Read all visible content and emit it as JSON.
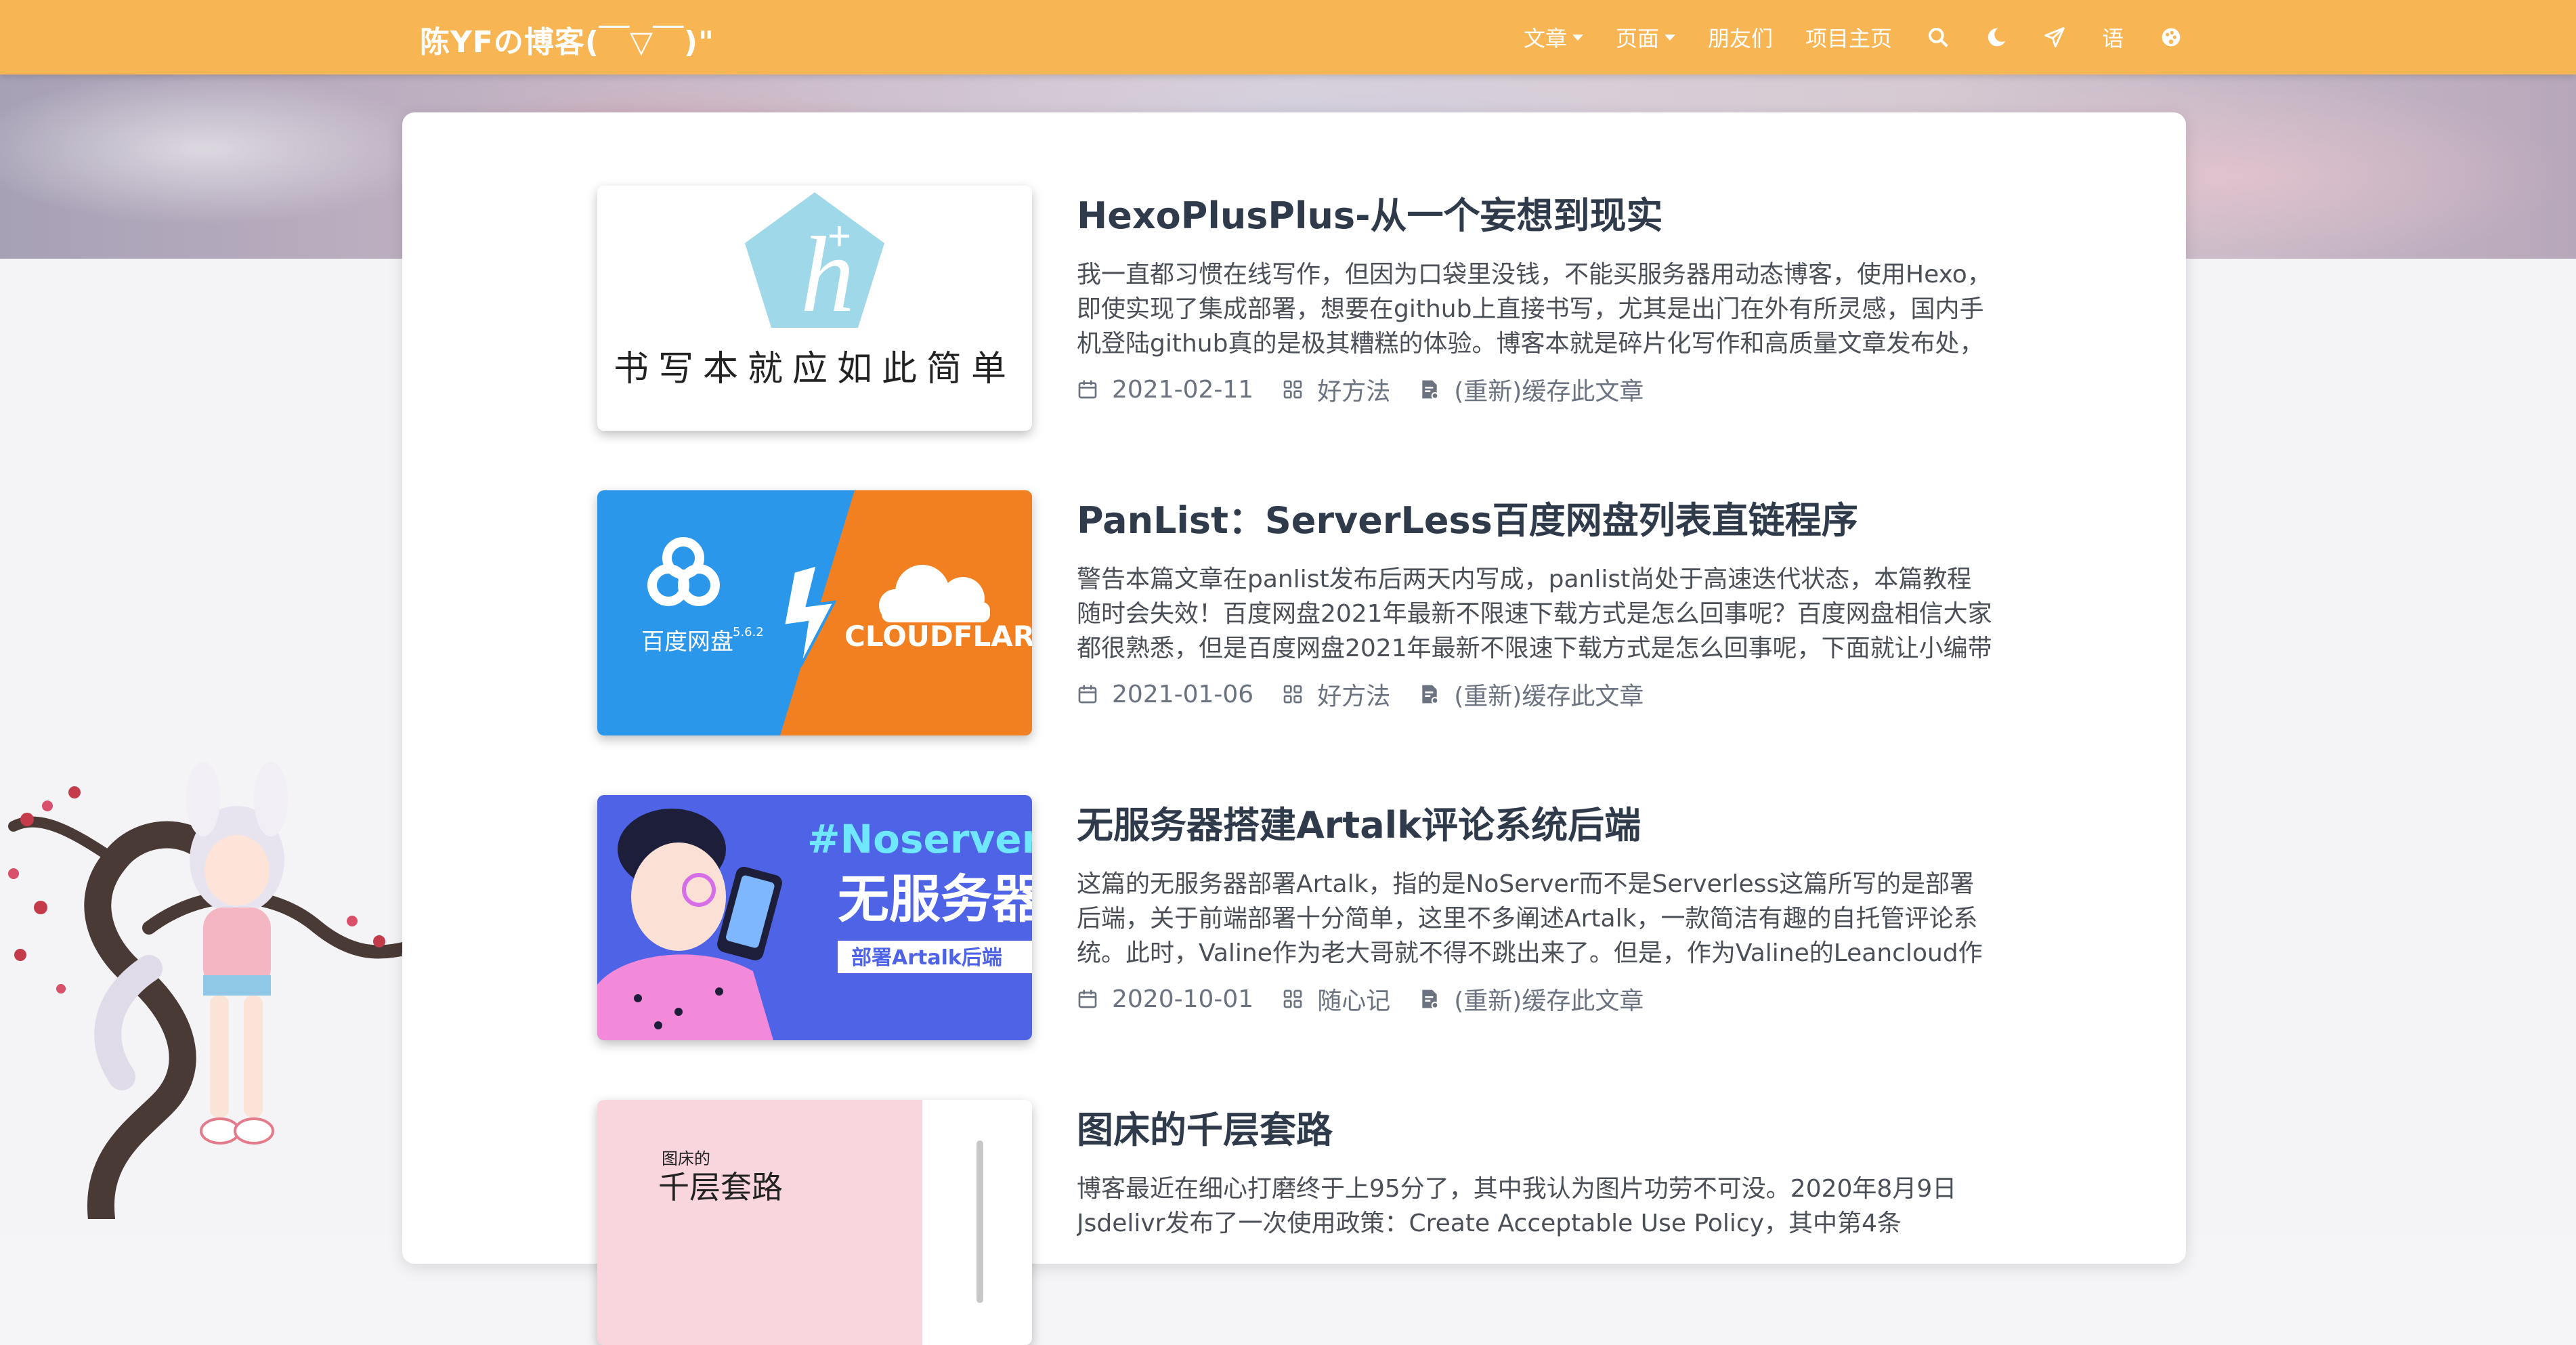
{
  "brand": "陈YFの博客(￣▽￣)\"",
  "nav": {
    "articles": "文章",
    "pages": "页面",
    "friends": "朋友们",
    "project_home": "项目主页",
    "language": "语"
  },
  "icons": {
    "search": "search-icon",
    "dark_mode": "moon-icon",
    "send": "paper-plane-icon",
    "theme": "palette-icon"
  },
  "colors": {
    "navbar": "#f8b553",
    "title": "#2f3a4b",
    "meta": "#6b7280"
  },
  "posts": [
    {
      "title": "HexoPlusPlus-从一个妄想到现实",
      "excerpt": "我一直都习惯在线写作，但因为口袋里没钱，不能买服务器用动态博客，使用Hexo，即使实现了集成部署，想要在github上直接书写，尤其是出门在外有所灵感，国内手机登陆github真的是极其糟糕的体验。博客本就是碎片化写作和高质量文章发布处，",
      "date": "2021-02-11",
      "category": "好方法",
      "cache": "(重新)缓存此文章",
      "thumb_text": "书写本就应如此简单"
    },
    {
      "title": "PanList：ServerLess百度网盘列表直链程序",
      "excerpt": "警告本篇文章在panlist发布后两天内写成，panlist尚处于高速迭代状态，本篇教程随时会失效！百度网盘2021年最新不限速下载方式是怎么回事呢？百度网盘相信大家都很熟悉，但是百度网盘2021年最新不限速下载方式是怎么回事呢，下面就让小编带大",
      "date": "2021-01-06",
      "category": "好方法",
      "cache": "(重新)缓存此文章",
      "thumb_left": "百度网盘",
      "thumb_version": "5.6.2",
      "thumb_right": "CLOUDFLARE"
    },
    {
      "title": "无服务器搭建Artalk评论系统后端",
      "excerpt": "这篇的无服务器部署Artalk，指的是NoServer而不是Serverless这篇所写的是部署后端，关于前端部署十分简单，这里不多阐述Artalk，一款简洁有趣的自托管评论系统。此时，Valine作为老大哥就不得不跳出来了。但是，作为Valine的Leancloud作",
      "date": "2020-10-01",
      "category": "随心记",
      "cache": "(重新)缓存此文章",
      "thumb_tag": "#Noserver",
      "thumb_big": "无服务器",
      "thumb_sub": "部署Artalk后端"
    },
    {
      "title": "图床的千层套路",
      "excerpt": "博客最近在细心打磨终于上95分了，其中我认为图片功劳不可没。2020年8月9日Jsdelivr发布了一次使用政策：Create Acceptable Use Policy，其中第4条",
      "thumb_small": "图床的",
      "thumb_big": "千层套路"
    }
  ]
}
